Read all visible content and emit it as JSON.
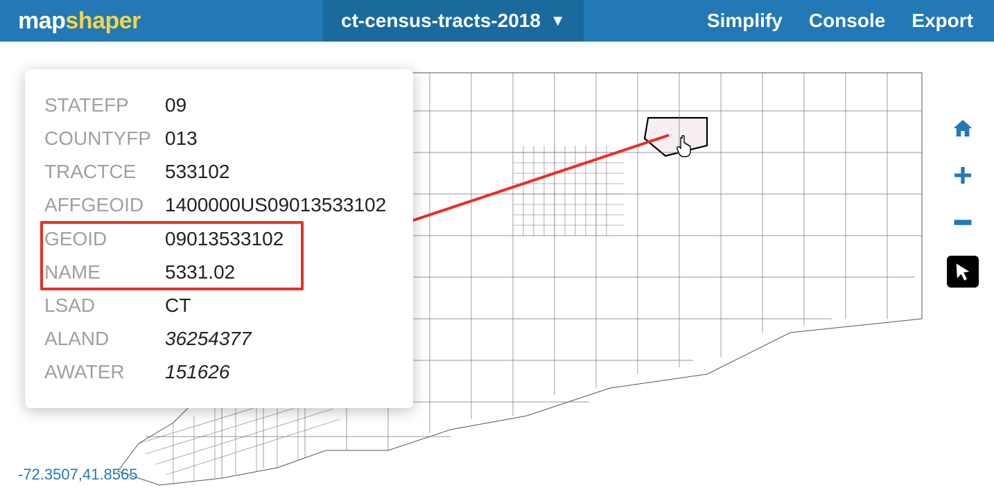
{
  "app": {
    "logo_part1": "map",
    "logo_part2": "shaper"
  },
  "layer": {
    "name": "ct-census-tracts-2018"
  },
  "nav": {
    "simplify": "Simplify",
    "console": "Console",
    "export": "Export"
  },
  "tools": {
    "home": "home-icon",
    "zoom_in": "plus-icon",
    "zoom_out": "minus-icon",
    "cursor": "cursor-icon"
  },
  "feature_info": {
    "rows": [
      {
        "key": "STATEFP",
        "value": "09",
        "numeric": false
      },
      {
        "key": "COUNTYFP",
        "value": "013",
        "numeric": false
      },
      {
        "key": "TRACTCE",
        "value": "533102",
        "numeric": false
      },
      {
        "key": "AFFGEOID",
        "value": "1400000US09013533102",
        "numeric": false
      },
      {
        "key": "GEOID",
        "value": "09013533102",
        "numeric": false,
        "highlighted": true
      },
      {
        "key": "NAME",
        "value": "5331.02",
        "numeric": false,
        "highlighted": true
      },
      {
        "key": "LSAD",
        "value": "CT",
        "numeric": false
      },
      {
        "key": "ALAND",
        "value": "36254377",
        "numeric": true
      },
      {
        "key": "AWATER",
        "value": "151626",
        "numeric": true
      }
    ]
  },
  "coords": {
    "text": "-72.3507,41.8565"
  },
  "colors": {
    "header": "#2279b5",
    "annotation": "#e73027"
  }
}
